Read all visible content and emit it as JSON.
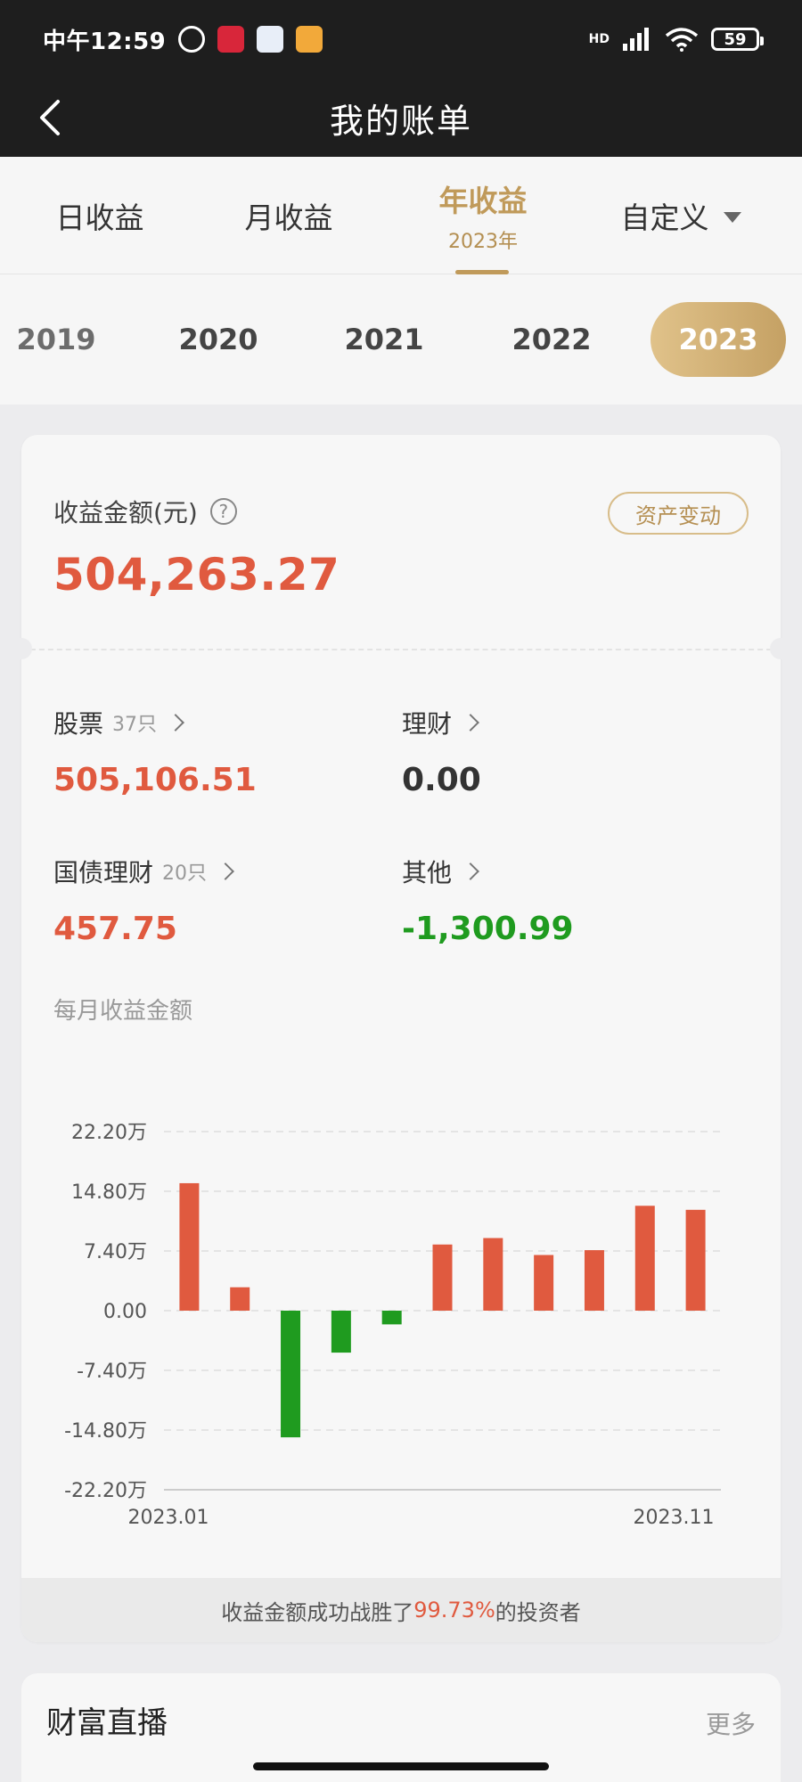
{
  "status": {
    "time": "中午12:59",
    "hd": "HD",
    "battery": "59",
    "icons": [
      "alarm-icon",
      "app-icon",
      "app-icon",
      "app-icon",
      "signal-icon",
      "wifi-icon",
      "battery-icon"
    ]
  },
  "header": {
    "title": "我的账单"
  },
  "tabs": {
    "day": "日收益",
    "month": "月收益",
    "year": "年收益",
    "year_sub": "2023年",
    "custom": "自定义"
  },
  "years": [
    "2019",
    "2020",
    "2021",
    "2022",
    "2023"
  ],
  "selected_year": "2023",
  "summary": {
    "label": "收益金额(元)",
    "help_icon": "question-circle-icon",
    "value": "504,263.27",
    "asset_change_label": "资产变动"
  },
  "categories": {
    "stocks": {
      "label": "股票",
      "count": "37只",
      "value": "505,106.51"
    },
    "wealth": {
      "label": "理财",
      "value": "0.00"
    },
    "bonds": {
      "label": "国债理财",
      "count": "20只",
      "value": "457.75"
    },
    "other": {
      "label": "其他",
      "value": "-1,300.99"
    }
  },
  "monthly_title": "每月收益金额",
  "colors": {
    "positive": "#e05a3f",
    "negative": "#1f9b1f",
    "accent": "#c5a164"
  },
  "chart_data": {
    "type": "bar",
    "x": [
      "2023.01",
      "2023.02",
      "2023.03",
      "2023.04",
      "2023.05",
      "2023.06",
      "2023.07",
      "2023.08",
      "2023.09",
      "2023.10",
      "2023.11"
    ],
    "values": [
      15.8,
      2.9,
      -15.7,
      -5.2,
      -1.7,
      8.2,
      9.0,
      6.9,
      7.5,
      13.0,
      12.5
    ],
    "value_unit": "万",
    "yticks": [
      "22.20万",
      "14.80万",
      "7.40万",
      "0.00",
      "-7.40万",
      "-14.80万",
      "-22.20万"
    ],
    "ylim": [
      -22.2,
      22.2
    ],
    "xtick_labels": [
      "2023.01",
      "2023.11"
    ],
    "grid": true,
    "title": "",
    "xlabel": "",
    "ylabel": ""
  },
  "beat": {
    "prefix": "收益金额成功战胜了",
    "percent": "99.73%",
    "suffix": "的投资者"
  },
  "section2": {
    "title": "财富直播",
    "more": "更多"
  }
}
